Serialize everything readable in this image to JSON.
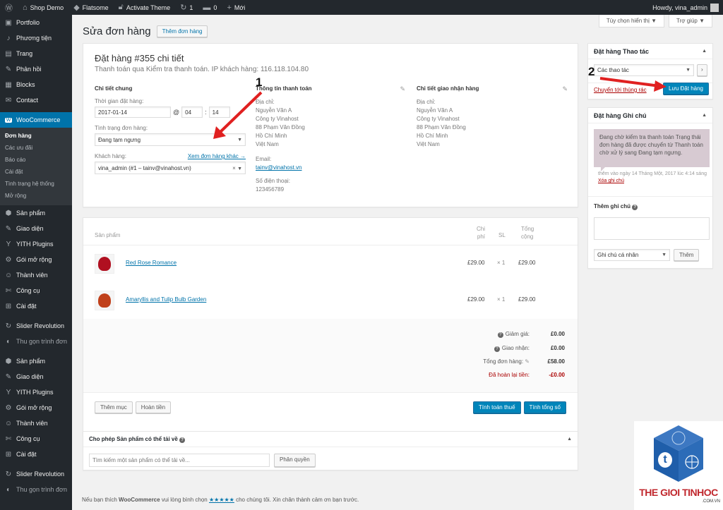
{
  "adminbar": {
    "site": "Shop Demo",
    "theme": "Flatsome",
    "activate": "Activate Theme",
    "updates": "1",
    "comments": "0",
    "new": "Mới",
    "howdy": "Howdy, vina_admin"
  },
  "sidebar": {
    "items": [
      {
        "icon": "▣",
        "label": "Portfolio"
      },
      {
        "icon": "♪",
        "label": "Phương tiện"
      },
      {
        "icon": "▤",
        "label": "Trang"
      },
      {
        "icon": "✎",
        "label": "Phản hồi"
      },
      {
        "icon": "▦",
        "label": "Blocks"
      },
      {
        "icon": "✉",
        "label": "Contact"
      }
    ],
    "woocommerce": "WooCommerce",
    "sub": [
      "Đơn hàng",
      "Các ưu đãi",
      "Báo cáo",
      "Cài đặt",
      "Tình trạng hệ thống",
      "Mở rộng"
    ],
    "items2": [
      {
        "icon": "⬢",
        "label": "Sản phẩm"
      },
      {
        "icon": "✎",
        "label": "Giao diện"
      },
      {
        "icon": "Y",
        "label": "YITH Plugins"
      },
      {
        "icon": "⚙",
        "label": "Gói mở rộng"
      },
      {
        "icon": "☺",
        "label": "Thành viên"
      },
      {
        "icon": "✄",
        "label": "Công cụ"
      },
      {
        "icon": "⊞",
        "label": "Cài đặt"
      }
    ],
    "items3": [
      {
        "icon": "↻",
        "label": "Slider Revolution"
      },
      {
        "icon": "◐",
        "label": "Thu gọn trình đơn"
      }
    ],
    "items4": [
      {
        "icon": "⬢",
        "label": "Sản phẩm"
      },
      {
        "icon": "✎",
        "label": "Giao diện"
      },
      {
        "icon": "Y",
        "label": "YITH Plugins"
      },
      {
        "icon": "⚙",
        "label": "Gói mở rộng"
      },
      {
        "icon": "☺",
        "label": "Thành viên"
      },
      {
        "icon": "✄",
        "label": "Công cụ"
      },
      {
        "icon": "⊞",
        "label": "Cài đặt"
      }
    ],
    "items5": [
      {
        "icon": "↻",
        "label": "Slider Revolution"
      },
      {
        "icon": "◐",
        "label": "Thu gọn trình đơn"
      }
    ]
  },
  "header": {
    "title": "Sửa đơn hàng",
    "add_button": "Thêm đơn hàng",
    "screen_options": "Tùy chọn hiển thị ▼",
    "help": "Trợ giúp ▼"
  },
  "order": {
    "title": "Đặt hàng #355 chi tiết",
    "subtitle": "Thanh toán qua Kiểm tra thanh toán. IP khách hàng: 116.118.104.80",
    "general": {
      "heading": "Chi tiết chung",
      "date_label": "Thời gian đặt hàng:",
      "date": "2017-01-14",
      "at": "@",
      "hour": "04",
      "minute": "14",
      "status_label": "Tình trạng đơn hàng:",
      "status": "Đang tạm ngưng",
      "customer_label": "Khách hàng:",
      "other_orders": "Xem đơn hàng khác →",
      "customer": "vina_admin (#1 – tainv@vinahost.vn)"
    },
    "billing": {
      "heading": "Thông tin thanh toán",
      "addr_label": "Địa chỉ:",
      "addr": [
        "Nguyễn Văn A",
        "Công ty Vinahost",
        "88 Phạm Văn Đồng",
        "Hồ Chí Minh",
        "Việt Nam"
      ],
      "email_label": "Email:",
      "email": "tainv@vinahost.vn",
      "phone_label": "Số điện thoại:",
      "phone": "123456789"
    },
    "shipping": {
      "heading": "Chi tiết giao nhận hàng",
      "addr_label": "Địa chỉ:",
      "addr": [
        "Nguyễn Văn A",
        "Công ty Vinahost",
        "88 Phạm Văn Đồng",
        "Hồ Chí Minh",
        "Việt Nam"
      ]
    }
  },
  "items": {
    "head_product": "Sản phẩm",
    "head_cost_1": "Chi",
    "head_cost_2": "phí",
    "head_qty": "SL",
    "head_total_1": "Tổng",
    "head_total_2": "cộng",
    "rows": [
      {
        "name": "Red Rose Romance",
        "cost": "£29.00",
        "qty": "× 1",
        "total": "£29.00"
      },
      {
        "name": "Amaryllis and Tulip Bulb Garden",
        "cost": "£29.00",
        "qty": "× 1",
        "total": "£29.00"
      }
    ],
    "discount_label": "Giảm giá:",
    "discount": "£0.00",
    "shipping_label": "Giao nhận:",
    "shipping": "£0.00",
    "total_label": "Tổng đơn hàng:",
    "total": "£58.00",
    "refund_label": "Đã hoàn lại tiền:",
    "refund": "-£0.00",
    "add_item": "Thêm mục",
    "refund_btn": "Hoàn tiền",
    "calc_tax": "Tính toán thuế",
    "calc_total": "Tính tổng số"
  },
  "downloads": {
    "title": "Cho phép Sản phẩm có thể tải về",
    "placeholder": "Tìm kiếm một sản phẩm có thể tải về...",
    "grant": "Phân quyền"
  },
  "actions": {
    "title": "Đặt hàng Thao tác",
    "select": "Các thao tác",
    "go": "›",
    "trash": "Chuyển tới thùng rác",
    "save": "Lưu Đặt hàng"
  },
  "notes": {
    "title": "Đặt hàng Ghi chú",
    "note_text": "Đang chờ kiểm tra thanh toán Trạng thái đơn hàng đã được chuyển từ Thanh toán chờ xử lý sang Đang tạm ngưng.",
    "meta": "thêm vào ngày 14 Tháng Một, 2017 lúc 4:14 sáng",
    "delete": "Xóa ghi chú",
    "add_label": "Thêm ghi chú",
    "type": "Ghi chú cá nhân",
    "add_btn": "Thêm"
  },
  "footer": {
    "pre": "Nếu bạn thích",
    "brand": "WooCommerce",
    "mid": "vui lòng bình chọn",
    "stars": "★★★★★",
    "post": "cho chúng tôi. Xin chân thành cảm ơn bạn trước."
  },
  "annotations": {
    "one": "1",
    "two": "2"
  },
  "logo": {
    "brand": "THE GIOI TINHOC",
    "domain": ".COM.VN",
    "letter": "t"
  },
  "colors": {
    "accent": "#0073aa",
    "button": "#0085ba",
    "arrow": "#e02020",
    "refund": "#a00"
  }
}
